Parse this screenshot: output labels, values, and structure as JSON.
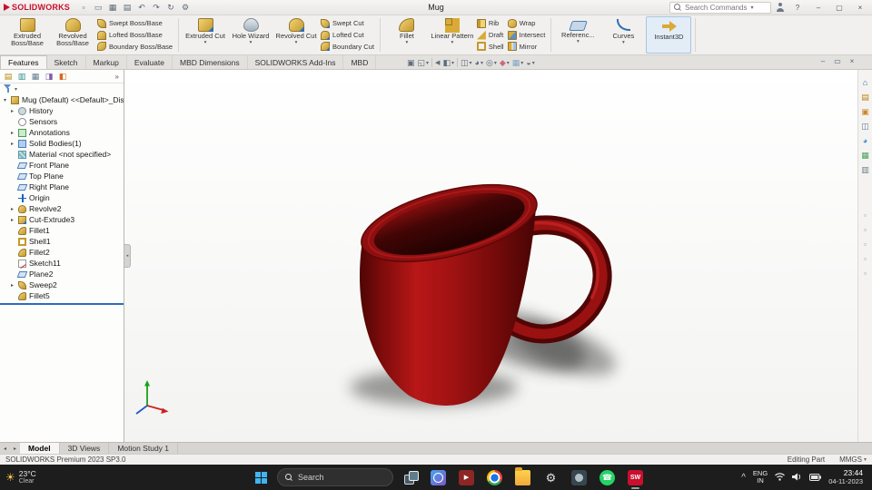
{
  "colors": {
    "solidworks_red": "#c8102e",
    "mug_red": "#b81717",
    "rollback_blue": "#2b6bc4",
    "taskbar_bg": "#1d1d1d",
    "whatsapp_green": "#25d366"
  },
  "titlebar": {
    "app_name": "SOLIDWORKS",
    "doc_title": "Mug",
    "search_placeholder": "Search Commands",
    "quick_icons": [
      "new",
      "open",
      "save",
      "print",
      "undo",
      "redo",
      "rebuild",
      "options"
    ],
    "window_controls": {
      "help": "?",
      "minimize": "–",
      "maximize": "▢",
      "close": "×"
    }
  },
  "command_tabs": [
    {
      "label": "Features",
      "state": "active"
    },
    {
      "label": "Sketch"
    },
    {
      "label": "Markup"
    },
    {
      "label": "Evaluate"
    },
    {
      "label": "MBD Dimensions"
    },
    {
      "label": "SOLIDWORKS Add-Ins"
    },
    {
      "label": "MBD"
    }
  ],
  "ribbon": {
    "extruded_boss": "Extruded Boss/Base",
    "revolved_boss": "Revolved Boss/Base",
    "swept_boss": "Swept Boss/Base",
    "lofted_boss": "Lofted Boss/Base",
    "boundary_boss": "Boundary Boss/Base",
    "extruded_cut": "Extruded Cut",
    "hole_wizard": "Hole Wizard",
    "revolved_cut": "Revolved Cut",
    "swept_cut": "Swept Cut",
    "lofted_cut": "Lofted Cut",
    "boundary_cut": "Boundary Cut",
    "fillet": "Fillet",
    "linear_pattern": "Linear Pattern",
    "rib": "Rib",
    "draft": "Draft",
    "shell": "Shell",
    "wrap": "Wrap",
    "intersect": "Intersect",
    "mirror": "Mirror",
    "reference": "Referenc...",
    "curves": "Curves",
    "instant3d": "Instant3D"
  },
  "headsup": [
    {
      "icon": "zoom-fit"
    },
    {
      "icon": "zoom-area",
      "dd": true
    },
    {
      "icon": "sep"
    },
    {
      "icon": "previous-view"
    },
    {
      "icon": "section-view",
      "dd": true
    },
    {
      "icon": "sep"
    },
    {
      "icon": "view-orientation",
      "dd": true
    },
    {
      "icon": "display-style",
      "dd": true
    },
    {
      "icon": "hide-show",
      "dd": true
    },
    {
      "icon": "edit-appearance",
      "dd": true
    },
    {
      "icon": "apply-scene",
      "dd": true
    },
    {
      "icon": "view-settings",
      "dd": true
    }
  ],
  "doc_window_controls": {
    "minimize": "–",
    "restore": "▭",
    "close": "×"
  },
  "left_panel": {
    "pane_tabs": [
      {
        "icon": "featuremanager"
      },
      {
        "icon": "propertymanager"
      },
      {
        "icon": "configurationmanager"
      },
      {
        "icon": "dimxpertmanager"
      },
      {
        "icon": "displaymanager"
      }
    ],
    "overflow_chevron": "»",
    "tree_items": [
      {
        "label": "Mug (Default) <<Default>_Display S",
        "icon": "part",
        "arrow": "▾",
        "state": "root"
      },
      {
        "label": "History",
        "icon": "history",
        "arrow": "▸"
      },
      {
        "label": "Sensors",
        "icon": "sensors",
        "arrow": ""
      },
      {
        "label": "Annotations",
        "icon": "annotations",
        "arrow": "▸"
      },
      {
        "label": "Solid Bodies(1)",
        "icon": "solid-bodies",
        "arrow": "▸"
      },
      {
        "label": "Material <not specified>",
        "icon": "material",
        "arrow": ""
      },
      {
        "label": "Front Plane",
        "icon": "plane",
        "arrow": ""
      },
      {
        "label": "Top Plane",
        "icon": "plane",
        "arrow": ""
      },
      {
        "label": "Right Plane",
        "icon": "plane",
        "arrow": ""
      },
      {
        "label": "Origin",
        "icon": "origin",
        "arrow": ""
      },
      {
        "label": "Revolve2",
        "icon": "revolve",
        "arrow": "▸"
      },
      {
        "label": "Cut-Extrude3",
        "icon": "cut-extrude",
        "arrow": "▸"
      },
      {
        "label": "Fillet1",
        "icon": "fillet",
        "arrow": ""
      },
      {
        "label": "Shell1",
        "icon": "shell",
        "arrow": ""
      },
      {
        "label": "Fillet2",
        "icon": "fillet",
        "arrow": ""
      },
      {
        "label": "Sketch11",
        "icon": "sketch",
        "arrow": ""
      },
      {
        "label": "Plane2",
        "icon": "plane",
        "arrow": ""
      },
      {
        "label": "Sweep2",
        "icon": "sweep",
        "arrow": "▸"
      },
      {
        "label": "Fillet5",
        "icon": "fillet",
        "arrow": ""
      }
    ]
  },
  "task_pane_icons": [
    {
      "icon": "home"
    },
    {
      "icon": "design-library"
    },
    {
      "icon": "file-explorer"
    },
    {
      "icon": "view-palette"
    },
    {
      "icon": "appearances"
    },
    {
      "icon": "scenes"
    },
    {
      "icon": "custom-properties"
    }
  ],
  "view_tool_icons": [
    {
      "icon": "tool"
    },
    {
      "icon": "tool"
    },
    {
      "icon": "tool"
    },
    {
      "icon": "tool"
    },
    {
      "icon": "tool"
    }
  ],
  "doc_tabs": [
    {
      "label": "Model",
      "state": "active"
    },
    {
      "label": "3D Views"
    },
    {
      "label": "Motion Study 1"
    }
  ],
  "statusbar": {
    "left": "SOLIDWORKS Premium 2023 SP3.0",
    "editing": "Editing Part",
    "units": "MMGS"
  },
  "taskbar": {
    "weather_temp": "23°C",
    "weather_desc": "Clear",
    "search_label": "Search",
    "apps": [
      {
        "icon": "task-view"
      },
      {
        "icon": "photos"
      },
      {
        "icon": "media-player"
      },
      {
        "icon": "chrome"
      },
      {
        "icon": "file-explorer"
      },
      {
        "icon": "settings"
      },
      {
        "icon": "camera"
      },
      {
        "icon": "whatsapp"
      },
      {
        "icon": "solidworks",
        "active": true
      }
    ],
    "tray": {
      "chevron": "^",
      "lang_top": "ENG",
      "lang_bottom": "IN",
      "time": "23:44",
      "date": "04-11-2023"
    }
  }
}
